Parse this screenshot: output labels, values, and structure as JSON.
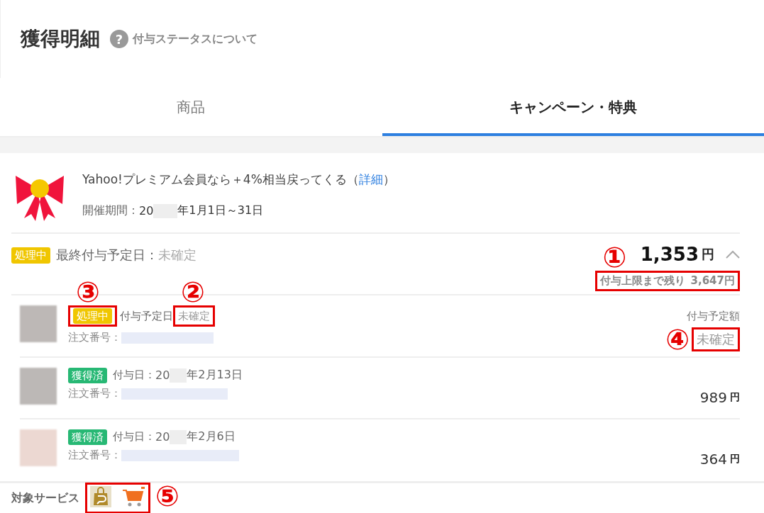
{
  "header": {
    "title": "獲得明細",
    "help_icon": "?",
    "help_link": "付与ステータスについて"
  },
  "tabs": [
    {
      "label": "商品",
      "selected": false
    },
    {
      "label": "キャンペーン・特典",
      "selected": true
    }
  ],
  "campaign": {
    "title": "Yahoo!プレミアム会員なら＋4%相当戻ってくる（",
    "link": "詳細",
    "title_end": "）",
    "period_label": "開催期間：",
    "period_start": "20",
    "period_end": "年1月1日～31日"
  },
  "summary": {
    "status": {
      "kind": "processing",
      "label": "処理中"
    },
    "date_label": "最終付与予定日：",
    "date_value": "未確定",
    "amount": "1,353",
    "currency": "円",
    "expanded": true,
    "remaining_label": "付与上限まで残り",
    "remaining_value": "3,647円",
    "remaining_marker": "①"
  },
  "items": [
    {
      "status": {
        "kind": "processing",
        "label": "処理中"
      },
      "status_marker": "③",
      "date": {
        "kind": "undecided",
        "label": "付与予定日",
        "value": "未確定",
        "marker": "②"
      },
      "order_label": "注文番号：",
      "amount": {
        "kind": "undecided",
        "label": "付与予定額",
        "value": "未確定",
        "marker": "④"
      }
    },
    {
      "status": {
        "kind": "earned",
        "label": "獲得済"
      },
      "date": {
        "kind": "date",
        "label": "付与日：",
        "start": "20",
        "end": "年2月13日"
      },
      "order_label": "注文番号：",
      "amount": {
        "kind": "value",
        "value": "989",
        "currency": "円"
      }
    },
    {
      "status": {
        "kind": "earned",
        "label": "獲得済"
      },
      "date": {
        "kind": "date",
        "label": "付与日：",
        "start": "20",
        "end": "年2月6日"
      },
      "order_label": "注文番号：",
      "amount": {
        "kind": "value",
        "value": "364",
        "currency": "円"
      }
    }
  ],
  "footer": {
    "label": "対象サービス",
    "services_marker": "⑤"
  }
}
